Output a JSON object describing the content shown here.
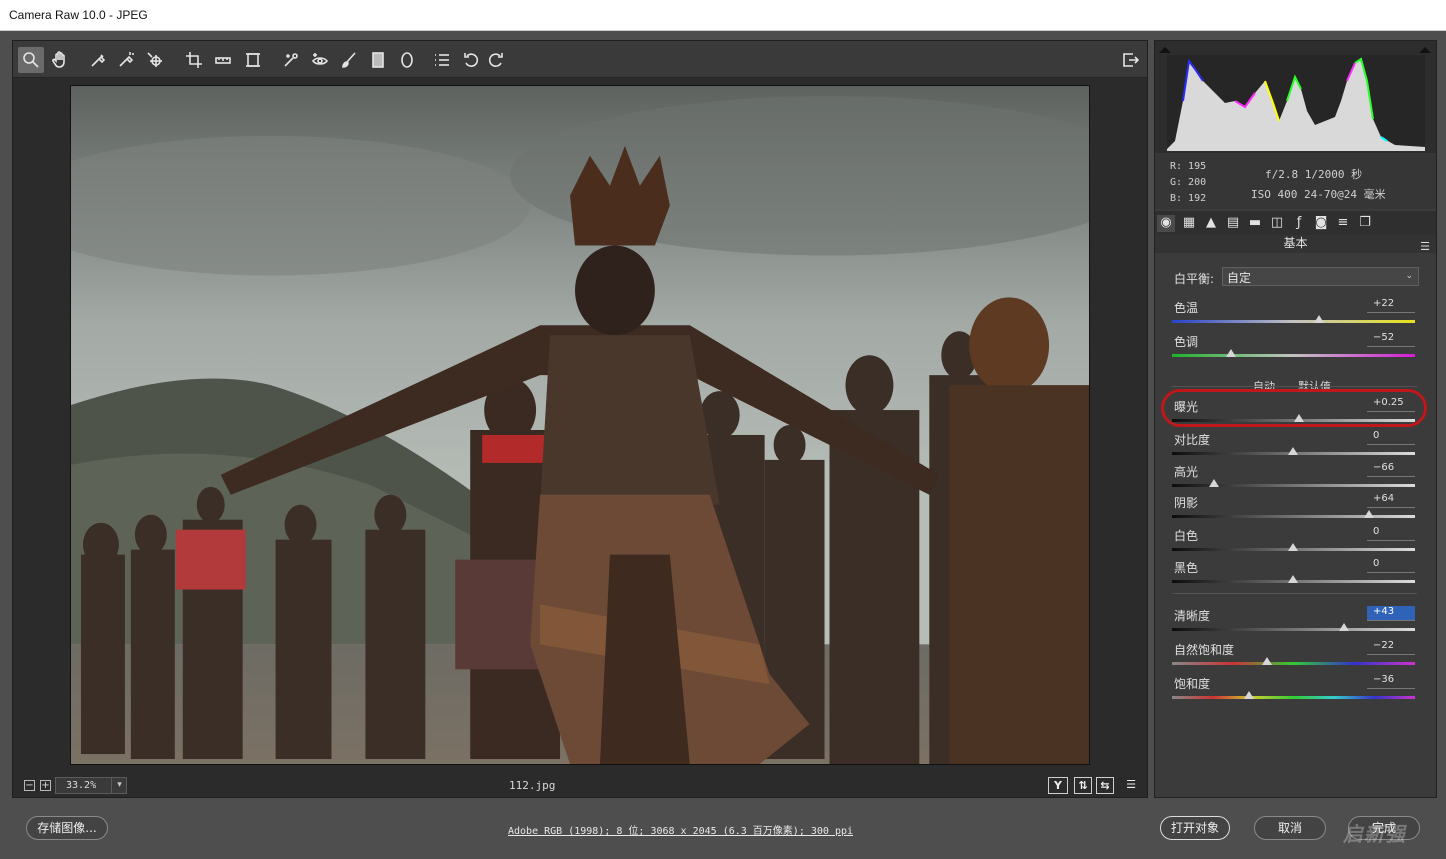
{
  "window": {
    "title": "Camera Raw 10.0 -  JPEG"
  },
  "toolbar": {
    "tools": [
      "zoom-icon",
      "hand-icon",
      "white-balance-icon",
      "color-sampler-icon",
      "targeted-adjust-icon",
      "crop-icon",
      "straighten-icon",
      "transform-icon",
      "spot-removal-icon",
      "red-eye-icon",
      "adjustment-brush-icon",
      "graduated-filter-icon",
      "radial-filter-icon",
      "preferences-icon",
      "rotate-ccw-icon",
      "rotate-cw-icon"
    ],
    "fullscreen_icon": "toggle-fullscreen-icon"
  },
  "status": {
    "zoom_minus": "−",
    "zoom_plus": "+",
    "zoom": "33.2%",
    "filename": "112.jpg",
    "before_after": "Y"
  },
  "info": {
    "r": "R:  195",
    "g": "G:  200",
    "b": "B:  192",
    "aperture_shutter": "f/2.8  1/2000 秒",
    "iso_lens": "ISO 400  24-70@24 毫米"
  },
  "panel": {
    "section_title": "基本",
    "wb_label": "白平衡:",
    "wb_value": "自定",
    "auto": "自动",
    "default": "默认值",
    "sliders": [
      {
        "label": "色温",
        "value": "+22"
      },
      {
        "label": "色调",
        "value": "−52"
      },
      {
        "label": "曝光",
        "value": "+0.25"
      },
      {
        "label": "对比度",
        "value": "0"
      },
      {
        "label": "高光",
        "value": "−66"
      },
      {
        "label": "阴影",
        "value": "+64"
      },
      {
        "label": "白色",
        "value": "0"
      },
      {
        "label": "黑色",
        "value": "0"
      },
      {
        "label": "清晰度",
        "value": "+43"
      },
      {
        "label": "自然饱和度",
        "value": "−22"
      },
      {
        "label": "饱和度",
        "value": "−36"
      }
    ]
  },
  "bottom": {
    "save": "存储图像...",
    "workflow": "Adobe RGB (1998); 8 位; 3068 x 2045 (6.3 百万像素); 300 ppi",
    "open": "打开对象",
    "cancel": "取消",
    "done": "完成",
    "watermark": "启新强"
  }
}
